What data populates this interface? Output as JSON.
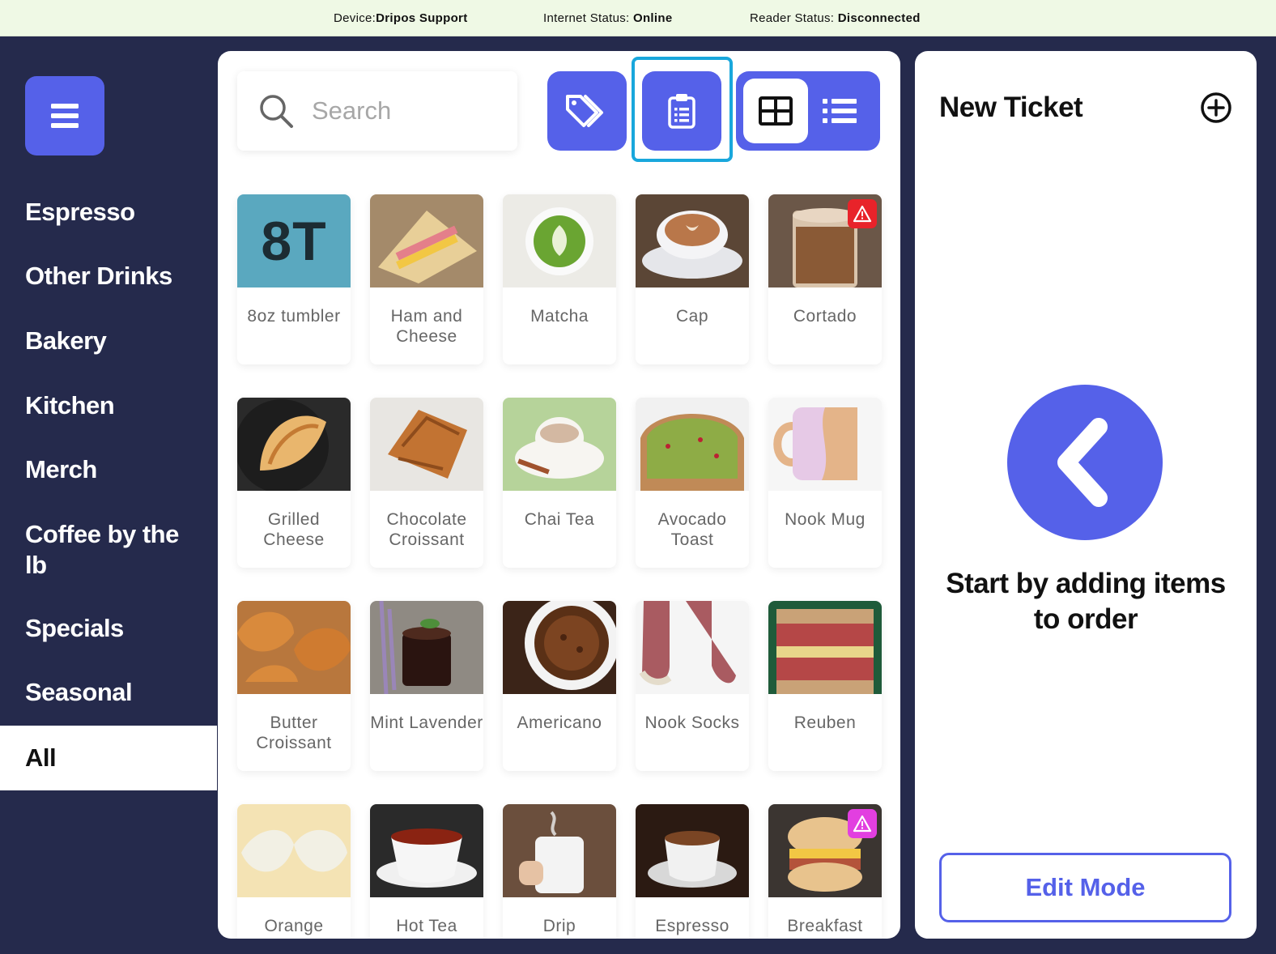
{
  "statusbar": {
    "device_label": "Device:",
    "device_value": "Dripos Support",
    "internet_label": "Internet Status: ",
    "internet_value": "Online",
    "reader_label": "Reader Status: ",
    "reader_value": "Disconnected"
  },
  "sidebar": {
    "menu_icon": "hamburger-icon",
    "categories": [
      {
        "label": "Espresso",
        "active": false
      },
      {
        "label": "Other Drinks",
        "active": false
      },
      {
        "label": "Bakery",
        "active": false
      },
      {
        "label": "Kitchen",
        "active": false
      },
      {
        "label": "Merch",
        "active": false
      },
      {
        "label": "Coffee by the lb",
        "active": false
      },
      {
        "label": "Specials",
        "active": false
      },
      {
        "label": "Seasonal",
        "active": false
      },
      {
        "label": "All",
        "active": true
      }
    ]
  },
  "toolbar": {
    "search_placeholder": "Search",
    "discount_icon": "tags-icon",
    "clipboard_icon": "clipboard-icon",
    "grid_view_icon": "grid-view-icon",
    "list_view_icon": "list-view-icon",
    "selected_view": "grid"
  },
  "items": [
    {
      "name": "8oz tumbler",
      "tile_text": "8T",
      "warning": null
    },
    {
      "name": "Ham and Cheese",
      "warning": null
    },
    {
      "name": "Matcha",
      "warning": null
    },
    {
      "name": "Cap",
      "warning": null
    },
    {
      "name": "Cortado",
      "warning": "red"
    },
    {
      "name": "Grilled Cheese",
      "warning": null
    },
    {
      "name": "Chocolate Croissant",
      "warning": null
    },
    {
      "name": "Chai Tea",
      "warning": null
    },
    {
      "name": "Avocado Toast",
      "warning": null
    },
    {
      "name": "Nook Mug",
      "warning": null
    },
    {
      "name": "Butter Croissant",
      "warning": null
    },
    {
      "name": "Mint Lavender",
      "warning": null
    },
    {
      "name": "Americano",
      "warning": null
    },
    {
      "name": "Nook Socks",
      "warning": null
    },
    {
      "name": "Reuben",
      "warning": null
    },
    {
      "name": "Orange",
      "warning": null
    },
    {
      "name": "Hot Tea",
      "warning": null
    },
    {
      "name": "Drip",
      "warning": null
    },
    {
      "name": "Espresso",
      "warning": null
    },
    {
      "name": "Breakfast",
      "warning": "magenta"
    }
  ],
  "ticket": {
    "title": "New Ticket",
    "add_icon": "plus-circle-icon",
    "back_icon": "chevron-left-icon",
    "empty_message": "Start by adding items to order",
    "edit_mode_label": "Edit Mode"
  },
  "colors": {
    "accent": "#5561e9",
    "sidebar_bg": "#252a4c",
    "statusbar_bg": "#eff9e5",
    "focus_ring": "#19a7dc",
    "warning_red": "#e8232a",
    "warning_magenta": "#e23fe0",
    "tumbler_tile": "#5aa8bf"
  }
}
